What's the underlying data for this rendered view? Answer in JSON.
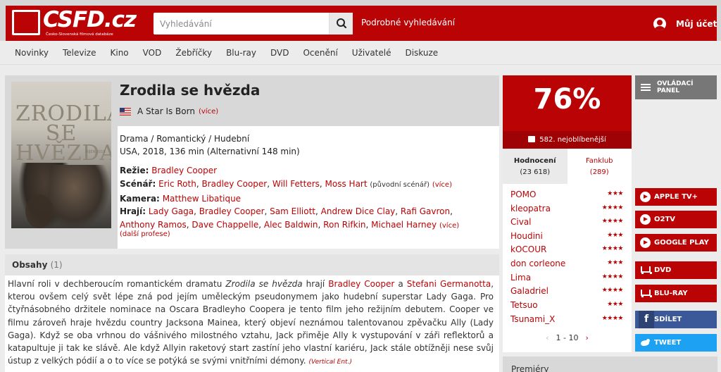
{
  "header": {
    "logo_text": "CSFD.cz",
    "logo_tagline": "Česko-Slovenská filmová databáze",
    "search_placeholder": "Vyhledávání",
    "advanced_search": "Podrobné vyhledávání",
    "account": "Můj účet"
  },
  "nav": [
    "Novinky",
    "Televize",
    "Kino",
    "VOD",
    "Žebříčky",
    "Blu-ray",
    "DVD",
    "Ocenění",
    "Uživatelé",
    "Diskuze"
  ],
  "film": {
    "poster_title": "ZRODILA SE HVĚZDA",
    "poster_date": "ŘÍJEN 2018",
    "title": "Zrodila se hvězda",
    "original_title": "A Star Is Born",
    "more": "(více)",
    "genre": "Drama / Romantický / Hudební",
    "origin": "USA, 2018, 136 min (Alternativní 148 min)",
    "direction_label": "Režie:",
    "directors": [
      "Bradley Cooper"
    ],
    "script_label": "Scénář:",
    "writers": [
      "Eric Roth",
      "Bradley Cooper",
      "Will Fetters",
      "Moss Hart"
    ],
    "writers_note": "(původní scénář)",
    "camera_label": "Kamera:",
    "camera": [
      "Matthew Libatique"
    ],
    "cast_label": "Hrají:",
    "cast": [
      "Lady Gaga",
      "Bradley Cooper",
      "Sam Elliott",
      "Andrew Dice Clay",
      "Rafi Gavron",
      "Anthony Ramos",
      "Dave Chappelle",
      "Alec Baldwin",
      "Ron Rifkin",
      "Michael Harney"
    ],
    "other_professions": "(další profese)"
  },
  "plot": {
    "heading": "Obsahy",
    "count": "(1)",
    "p1": "Hlavní roli v dechberoucím romantickém dramatu ",
    "film_title": "Zrodila se hvězda",
    "p2": " hrají ",
    "actor1": "Bradley Cooper",
    "p3": " a ",
    "actor2": "Stefani Germanotta",
    "p4": ", kterou ovšem celý svět lépe zná pod jejím uměleckým pseudonymem jako hudební superstar Lady Gaga. Pro čtyřnásobného držitele nominace na Oscara Bradleyho Coopera je tento film jeho režijním debutem. Cooper ve filmu zároveň hraje hvězdu country Jacksona Mainea, který objeví neznámou talentovanou zpěvačku Ally (Lady Gaga). Když se oba vrhnou do vášnivého milostného vztahu, Jack přiměje Ally k vystupování v záři reflektorů a katapultuje ji tak ke slávě. Ale když Allyin raketový start zastíní jeho vlastní kariéru, Jack stále obtížněji nese svůj ústup z velkých pódií a o to více se potýká se svými vnitřními démony.",
    "source": "(Vertical Ent.)"
  },
  "rating": {
    "percent": "76%",
    "rank": "582. nejoblíbenější",
    "tab_ratings": "Hodnocení",
    "tab_ratings_count": "(23 618)",
    "tab_fanclub": "Fanklub",
    "tab_fanclub_count": "(289)",
    "users": [
      {
        "name": "POMO",
        "stars": "★★★"
      },
      {
        "name": "kleopatra",
        "stars": "★★★★"
      },
      {
        "name": "Cival",
        "stars": "★★★★"
      },
      {
        "name": "Houdini",
        "stars": "★★★"
      },
      {
        "name": "kOCOUR",
        "stars": "★★★★"
      },
      {
        "name": "don corleone",
        "stars": "★★★"
      },
      {
        "name": "Lima",
        "stars": "★★★★"
      },
      {
        "name": "Galadriel",
        "stars": "★★★★"
      },
      {
        "name": "Tetsuo",
        "stars": "★★★"
      },
      {
        "name": "Tsunami_X",
        "stars": "★★★★"
      }
    ],
    "pager": "1 - 10"
  },
  "side": {
    "control_panel_1": "OVLÁDACÍ",
    "control_panel_2": "PANEL",
    "vod": [
      "APPLE TV+",
      "O2TV",
      "GOOGLE PLAY"
    ],
    "shop": [
      "DVD",
      "BLU-RAY"
    ],
    "share": "SDÍLET",
    "tweet": "TWEET",
    "premieres": "Premiéry"
  }
}
